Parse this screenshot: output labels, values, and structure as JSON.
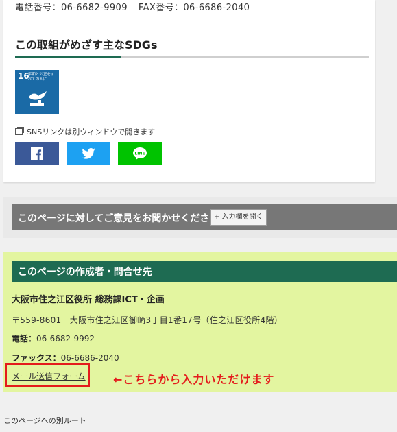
{
  "contact": {
    "tel_label": "電話番号：06-6682-9909",
    "fax_label": "FAX番号：06-6686-2040"
  },
  "sdgs": {
    "heading": "この取組がめざす主なSDGs",
    "goal_number": "16",
    "goal_title": "平和と公正をすべての人に",
    "icon_color": "#1a6aa6",
    "accent_color": "#1e6b52"
  },
  "sns": {
    "note": "SNSリンクは別ウィンドウで開きます",
    "buttons": [
      {
        "name": "facebook",
        "color": "#3b5998"
      },
      {
        "name": "twitter",
        "color": "#1da1f2"
      },
      {
        "name": "line",
        "color": "#00c300",
        "label": "LINE"
      }
    ]
  },
  "opinion": {
    "title": "このページに対してご意見をお聞かせください",
    "open_button": "+ 入力欄を開く"
  },
  "author": {
    "title": "このページの作成者・問合せ先",
    "dept": "大阪市住之江区役所 総務課ICT・企画",
    "address": "〒559-8601　大阪市住之江区御崎3丁目1番17号（住之江区役所4階）",
    "tel_label": "電話：",
    "tel_value": "06-6682-9992",
    "fax_label": "ファックス：",
    "fax_value": "06-6686-2040",
    "mail_link": "メール送信フォーム",
    "annotation": "←こちらから入力いただけます",
    "box_color": "#e3f5a0",
    "highlight_color": "#e41c1c"
  },
  "footer": {
    "route": "このページへの別ルート"
  }
}
